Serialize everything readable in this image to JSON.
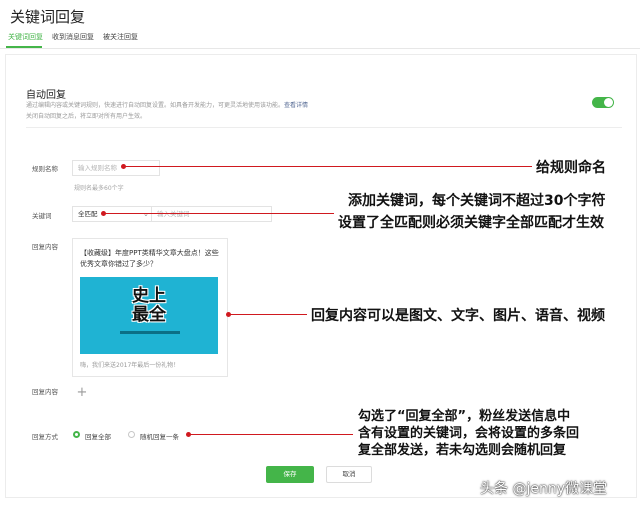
{
  "header": {
    "title": "关键词回复",
    "tabs": [
      {
        "label": "关键词回复",
        "active": true
      },
      {
        "label": "收到消息回复",
        "active": false
      },
      {
        "label": "被关注回复",
        "active": false
      }
    ]
  },
  "auto_reply": {
    "title": "自动回复",
    "desc_line1": "通过编辑内容或关键词规则，快速进行自动回复设置。如具备开发能力，可更灵活地使用该功能。",
    "desc_link": "查看详情",
    "desc_line2": "关闭自动回复之后，将立即对所有用户生效。",
    "toggle_on": true
  },
  "form": {
    "rule_name_label": "规则名称",
    "rule_name_placeholder": "输入规则名称",
    "rule_name_hint": "规则名最多60个字",
    "keyword_label": "关键词",
    "match_mode": "全匹配",
    "keyword_placeholder": "输入关键词",
    "reply_content_label": "回复内容",
    "card_title": "【收藏级】年度PPT类精华文章大盘点！这些优秀文章你错过了多少？",
    "cover_text": "史上最全",
    "card_footer": "嗨，我们来送2017年最后一份礼物！",
    "reply_content_label2": "回复内容",
    "reply_mode_label": "回复方式",
    "reply_options": [
      {
        "label": "回复全部",
        "selected": true
      },
      {
        "label": "随机回复一条",
        "selected": false
      }
    ],
    "save_label": "保存",
    "cancel_label": "取消"
  },
  "annotations": {
    "name_rule": "给规则命名",
    "keyword_line1": "添加关键词，每个关键词不超过30个字符",
    "keyword_line2": "设置了全匹配则必须关键字全部匹配才生效",
    "content": "回复内容可以是图文、文字、图片、语音、视频",
    "mode_line1": "勾选了“回复全部”，粉丝发送信息中",
    "mode_line2": "含有设置的关键词，会将设置的多条回",
    "mode_line3": "复全部发送，若未勾选则会随机回复",
    "accent_color": "#d0191f"
  },
  "watermark": "头条 @jenny微课堂",
  "colors": {
    "brand_green": "#44b549",
    "link": "#576b95"
  }
}
